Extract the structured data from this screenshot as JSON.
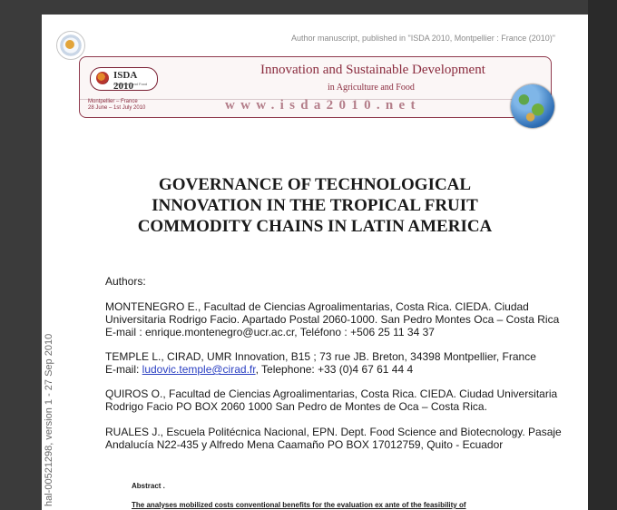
{
  "header": {
    "manuscript_note": "Author manuscript, published in \"ISDA 2010, Montpellier : France (2010)\""
  },
  "banner": {
    "logo_text": "ISDA 2010",
    "logo_subtext": "Agriculture and Food",
    "title": "Innovation and Sustainable Development",
    "subtitle": "in Agriculture and Food",
    "place": "Montpellier – France",
    "dates": "28 June – 1st July 2010",
    "url": "www.isda2010.net",
    "accent_color": "#8a2b3e"
  },
  "side_stamp": "hal-00521298, version 1 - 27 Sep 2010",
  "paper": {
    "title_line1": "GOVERNANCE OF TECHNOLOGICAL",
    "title_line2": "INNOVATION IN THE TROPICAL FRUIT",
    "title_line3": "COMMODITY CHAINS IN LATIN AMERICA",
    "authors_label": "Authors:",
    "authors": [
      {
        "line1": "MONTENEGRO E., Facultad de Ciencias Agroalimentarias, Costa Rica. CIEDA. Ciudad",
        "line2": "Universitaria Rodrigo Facio. Apartado Postal 2060-1000. San Pedro Montes Oca – Costa Rica",
        "line3": "E-mail : enrique.montenegro@ucr.ac.cr, Teléfono : +506 25 11 34 37"
      },
      {
        "line1": "TEMPLE L.,  CIRAD, UMR Innovation, B15 ; 73 rue JB. Breton, 34398 Montpellier, France",
        "email_prefix": "E-mail: ",
        "email": "ludovic.temple@cirad.fr",
        "email_suffix": ", Telephone: +33 (0)4 67 61 44 4"
      },
      {
        "line1": "QUIROS O., Facultad de Ciencias Agroalimentarias, Costa Rica. CIEDA. Ciudad Universitaria",
        "line2": "Rodrigo Facio PO BOX 2060 1000 San Pedro de Montes de Oca – Costa Rica."
      },
      {
        "line1": "RUALES J., Escuela Politécnica Nacional, EPN. Dept. Food Science and Biotecnology. Pasaje",
        "line2": "Andalucía N22-435 y Alfredo Mena Caamaño PO BOX 17012759, Quito - Ecuador"
      }
    ],
    "abstract_heading": "Abstract .",
    "abstract_first_line": "The analyses mobilized costs conventional benefits for the evaluation ex ante of the feasibility of"
  }
}
